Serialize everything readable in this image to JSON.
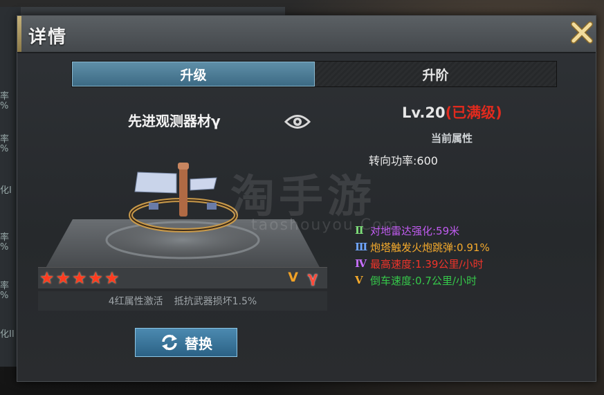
{
  "dialog": {
    "title": "详情"
  },
  "tabs": [
    {
      "label": "升级",
      "active": true
    },
    {
      "label": "升阶",
      "active": false
    }
  ],
  "item": {
    "name": "先进观测器材γ",
    "stars": 5,
    "grade_v": "V",
    "grade_y": "γ",
    "bonus_left": "4红属性激活",
    "bonus_right": "抵抗武器损坏1.5%",
    "replace_label": "替换"
  },
  "stats": {
    "level": "Lv.20",
    "level_status": "(已满级)",
    "current_label": "当前属性",
    "base": "转向功率:600",
    "attributes": [
      {
        "tier": "Ⅱ",
        "text": "对地雷达强化:59米",
        "color": "#c05cf0",
        "tier_color": "#7fe07a"
      },
      {
        "tier": "Ⅲ",
        "text": "炮塔触发火炮跳弹:0.91%",
        "color": "#f3a92c",
        "tier_color": "#6fa6ff"
      },
      {
        "tier": "Ⅳ",
        "text": "最高速度:1.39公里/小时",
        "color": "#f0342a",
        "tier_color": "#c870ff"
      },
      {
        "tier": "V",
        "text": "倒车速度:0.7公里/小时",
        "color": "#36c84a",
        "tier_color": "#f3a92c"
      }
    ]
  },
  "watermark": {
    "text": "淘手游",
    "url": "taoshouyou.Com"
  },
  "background": {
    "side_items": [
      "率",
      "%",
      "率",
      "%",
      "化I",
      "率",
      "%",
      "率",
      "%",
      "化II"
    ]
  },
  "colors": {
    "accent_tab": "#3c6a84",
    "maxed": "#e02a1e",
    "star": "#ff3b1f"
  }
}
